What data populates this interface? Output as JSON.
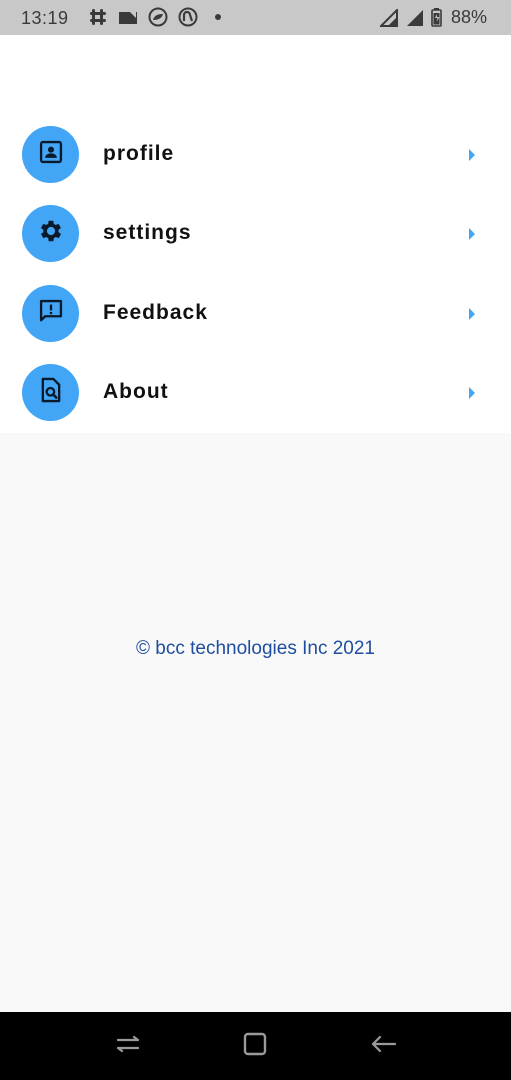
{
  "status_bar": {
    "time": "13:19",
    "battery": "88%",
    "left_icons": [
      "slack-icon",
      "tape-icon",
      "cloud-icon",
      "sync-icon",
      "dot-icon"
    ],
    "right_icons": [
      "signal-icon",
      "signal-icon",
      "battery-icon"
    ]
  },
  "menu": {
    "items": [
      {
        "label": "profile",
        "icon": "profile-icon"
      },
      {
        "label": "settings",
        "icon": "gear-icon"
      },
      {
        "label": "Feedback",
        "icon": "feedback-icon"
      },
      {
        "label": "About",
        "icon": "document-search-icon"
      }
    ]
  },
  "footer": {
    "copyright": "© bcc technologies Inc 2021"
  },
  "nav": {
    "buttons": [
      "recents-button",
      "home-button",
      "back-button"
    ]
  },
  "colors": {
    "accent": "#42a5f5",
    "footer_text": "#1f4ea1",
    "status_bar": "#c8c8c8",
    "background": "#f9f9f9"
  }
}
